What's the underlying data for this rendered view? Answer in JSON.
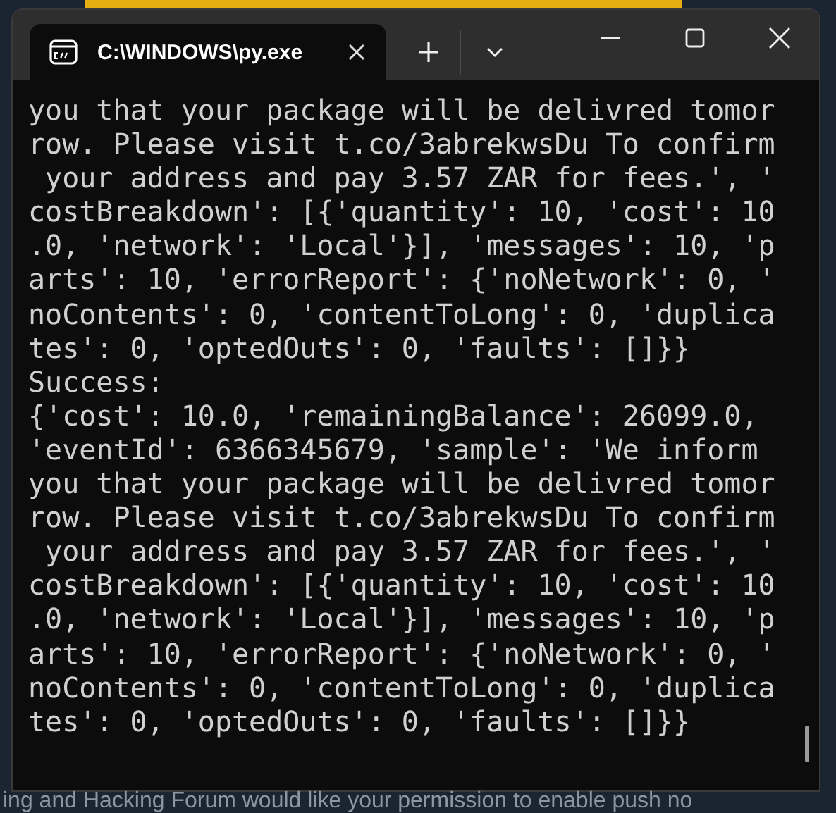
{
  "window": {
    "tab": {
      "title": "C:\\WINDOWS\\py.exe",
      "selected": true
    }
  },
  "terminal": {
    "lines": [
      "you that your package will be delivred tomor",
      "row. Please visit t.co/3abrekwsDu To confirm",
      " your address and pay 3.57 ZAR for fees.', '",
      "costBreakdown': [{'quantity': 10, 'cost': 10",
      ".0, 'network': 'Local'}], 'messages': 10, 'p",
      "arts': 10, 'errorReport': {'noNetwork': 0, '",
      "noContents': 0, 'contentToLong': 0, 'duplica",
      "tes': 0, 'optedOuts': 0, 'faults': []}}",
      "Success:",
      "{'cost': 10.0, 'remainingBalance': 26099.0,",
      "'eventId': 6366345679, 'sample': 'We inform",
      "you that your package will be delivred tomor",
      "row. Please visit t.co/3abrekwsDu To confirm",
      " your address and pay 3.57 ZAR for fees.', '",
      "costBreakdown': [{'quantity': 10, 'cost': 10",
      ".0, 'network': 'Local'}], 'messages': 10, 'p",
      "arts': 10, 'errorReport': {'noNetwork': 0, '",
      "noContents': 0, 'contentToLong': 0, 'duplica",
      "tes': 0, 'optedOuts': 0, 'faults': []}}"
    ]
  },
  "background": {
    "notice": "ing and Hacking Forum would like your permission to enable push no"
  }
}
